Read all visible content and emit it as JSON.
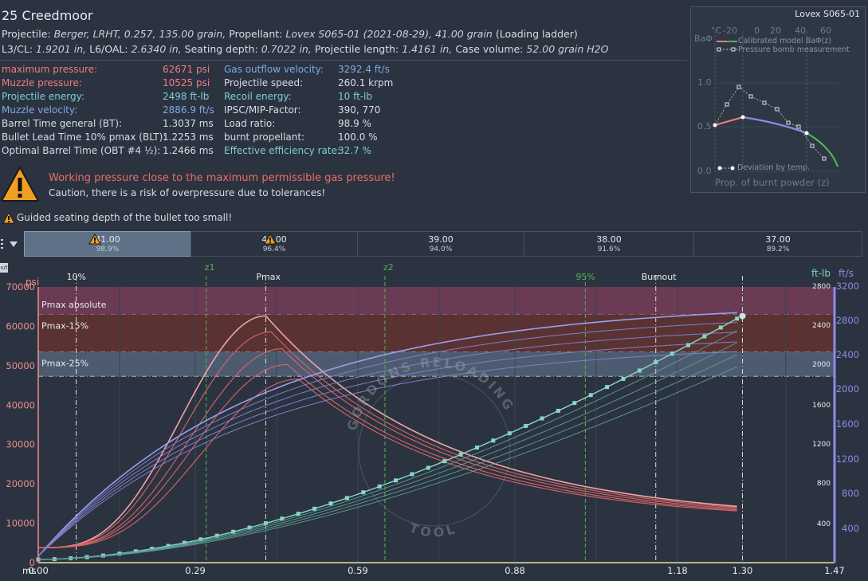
{
  "title": "25 Creedmoor",
  "info": {
    "projectile_label": "Projectile:",
    "projectile_value": "Berger, LRHT, 0.257, 135.00 grain,",
    "propellant_label": "Propellant:",
    "propellant_value": "Lovex S065-01 (2021-08-29), 41.00 grain",
    "loading_ladder": "(Loading ladder)",
    "l3cl_label": "L3/CL:",
    "l3cl_value": "1.9201 in,",
    "l6oal_label": "L6/OAL:",
    "l6oal_value": "2.6340 in,",
    "seating_label": "Seating depth:",
    "seating_value": "0.7022 in,",
    "projlen_label": "Projectile length:",
    "projlen_value": "1.4161 in,",
    "casevol_label": "Case volume:",
    "casevol_value": "52.00 grain H2O"
  },
  "metrics_left": [
    {
      "label": "maximum pressure:",
      "value": "62671 psi",
      "color": "red"
    },
    {
      "label": "Muzzle pressure:",
      "value": "10525 psi",
      "color": "red"
    },
    {
      "label": "Projectile energy:",
      "value": "2498 ft-lb",
      "color": "teal"
    },
    {
      "label": "Muzzle velocity:",
      "value": "2886.9 ft/s",
      "color": "blue"
    },
    {
      "label": "Barrel Time general (BT):",
      "value": "1.3037 ms",
      "color": "plain"
    },
    {
      "label": "Bullet Lead Time 10% pmax (BLT):",
      "value": "1.2253 ms",
      "color": "plain"
    },
    {
      "label": "Optimal Barrel Time (OBT #4 ½):",
      "value": "1.2466 ms",
      "color": "plain"
    }
  ],
  "metrics_right": [
    {
      "label": "Gas outflow velocity:",
      "value": "3292.4 ft/s",
      "color": "blue"
    },
    {
      "label": "Projectile speed:",
      "value": "260.1 krpm",
      "color": "plain"
    },
    {
      "label": "Recoil energy:",
      "value": "10 ft-lb",
      "color": "teal"
    },
    {
      "label": "IPSC/MIP-Factor:",
      "value": "390, 770",
      "color": "plain"
    },
    {
      "label": "Load ratio:",
      "value": "98.9 %",
      "color": "plain"
    },
    {
      "label": "burnt propellant:",
      "value": "100.0 %",
      "color": "plain"
    },
    {
      "label": "Effective efficiency rate:",
      "value": "32.7 %",
      "color": "teal"
    }
  ],
  "warning": {
    "title": "Working pressure close to the maximum permissible gas pressure!",
    "subtitle": "Caution, there is a risk of overpressure due to tolerances!",
    "seating": "Guided seating depth of the bullet too small!"
  },
  "mini_chart": {
    "title": "Lovex S065-01",
    "temp_unit": "°C",
    "temp_ticks": [
      "-20",
      "0",
      "20",
      "40",
      "60"
    ],
    "ylabel": "BaΦ",
    "yticks": [
      "1.0",
      "0.5",
      "0.0"
    ],
    "legend_model": "Calibrated model BaΦ(z)",
    "legend_bomb": "Pressure bomb measurement",
    "legend_dev": "Deviation by temp.",
    "xlabel": "Prop. of burnt powder (z)"
  },
  "tabs": [
    {
      "value": "41.00",
      "percent": "98.9%",
      "warn": true,
      "active": true
    },
    {
      "value": "40.00",
      "percent": "96.4%",
      "warn": true,
      "active": false
    },
    {
      "value": "39.00",
      "percent": "94.0%",
      "warn": false,
      "active": false
    },
    {
      "value": "38.00",
      "percent": "91.6%",
      "warn": false,
      "active": false
    },
    {
      "value": "37.00",
      "percent": "89.2%",
      "warn": false,
      "active": false
    }
  ],
  "menu_icon": "list-icon",
  "chart_toggle": "v/t",
  "chart_data": {
    "type": "line",
    "x_unit": "ms",
    "xticks": [
      "0.00",
      "0.29",
      "0.59",
      "0.88",
      "1.18",
      "1.30",
      "1.47"
    ],
    "xlim": [
      0,
      1.47
    ],
    "ylabel_left": "psi",
    "ylim_left": [
      0,
      70000
    ],
    "yticks_left": [
      "0",
      "10000",
      "20000",
      "30000",
      "40000",
      "50000",
      "60000",
      "70000"
    ],
    "ylabel_energy": "ft-lb",
    "yticks_energy": [
      "400",
      "800",
      "1200",
      "1600",
      "2000",
      "2400",
      "2800"
    ],
    "ylabel_velocity": "ft/s",
    "yticks_velocity": [
      "400",
      "800",
      "1200",
      "1600",
      "2000",
      "2400",
      "2800",
      "3200"
    ],
    "markers": [
      {
        "label": "10%",
        "x": 0.07
      },
      {
        "label": "z1",
        "x": 0.31
      },
      {
        "label": "Pmax",
        "x": 0.42
      },
      {
        "label": "z2",
        "x": 0.64
      },
      {
        "label": "95%",
        "x": 1.01
      },
      {
        "label": "Burnout",
        "x": 1.14
      },
      {
        "label": "",
        "x": 1.3
      }
    ],
    "bands": [
      {
        "label": "Pmax absolute",
        "from": 63000,
        "to": 70000,
        "color": "#6b3a55"
      },
      {
        "label": "Pmax-15%",
        "from": 53500,
        "to": 63000,
        "color": "#5a3232"
      },
      {
        "label": "Pmax-25%",
        "from": 47300,
        "to": 53500,
        "color": "#4d5b70"
      }
    ],
    "pressure_series": [
      {
        "charge": "41.00",
        "peak": 62671,
        "peak_t": 0.42
      },
      {
        "charge": "40.00",
        "peak": 58600,
        "peak_t": 0.43
      },
      {
        "charge": "39.00",
        "peak": 54300,
        "peak_t": 0.45
      },
      {
        "charge": "38.00",
        "peak": 50300,
        "peak_t": 0.46
      },
      {
        "charge": "37.00",
        "peak": 46600,
        "peak_t": 0.48
      }
    ],
    "muzzle_pressure": 10525,
    "velocity_end": 2886.9,
    "energy_end": 2498
  },
  "watermark": {
    "top": "GORDONS RELOADING",
    "bottom": "TOOL"
  },
  "colors": {
    "bg": "#2b3340",
    "pressure": "#f08c8c",
    "velocity": "#8c8ce6",
    "energy": "#7fd0c0",
    "marker_green": "#58b058"
  }
}
